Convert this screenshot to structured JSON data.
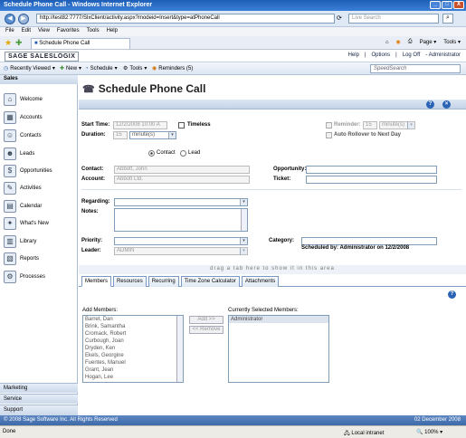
{
  "window": {
    "title": "Schedule Phone Call - Windows Internet Explorer",
    "min": "_",
    "max": "□",
    "close": "X"
  },
  "browser": {
    "url": "http://test82:7777/SlxClient/activity.aspx?modeid=Insert&type=atPhoneCall",
    "search_placeholder": "Live Search",
    "menu": [
      "File",
      "Edit",
      "View",
      "Favorites",
      "Tools",
      "Help"
    ],
    "tab_label": "Schedule Phone Call",
    "tools": [
      "Page",
      "Tools"
    ]
  },
  "app": {
    "logo": "SAGE SALESLOGIX",
    "header_links": [
      "Help",
      "Options",
      "Log Off",
      "- Administrator"
    ],
    "toolbar": [
      "Recently Viewed",
      "New",
      "Schedule",
      "Tools",
      "Reminders (5)"
    ],
    "speed_search": "SpeedSearch"
  },
  "sidebar": {
    "header": "Sales",
    "items": [
      {
        "label": "Welcome",
        "icon": "welcome-icon"
      },
      {
        "label": "Accounts",
        "icon": "accounts-icon"
      },
      {
        "label": "Contacts",
        "icon": "contacts-icon"
      },
      {
        "label": "Leads",
        "icon": "leads-icon"
      },
      {
        "label": "Opportunities",
        "icon": "opportunities-icon"
      },
      {
        "label": "Activities",
        "icon": "activities-icon"
      },
      {
        "label": "Calendar",
        "icon": "calendar-icon"
      },
      {
        "label": "What's New",
        "icon": "whats-new-icon"
      },
      {
        "label": "Library",
        "icon": "library-icon"
      },
      {
        "label": "Reports",
        "icon": "reports-icon"
      },
      {
        "label": "Processes",
        "icon": "processes-icon"
      }
    ],
    "footer": [
      "Marketing",
      "Service",
      "Support"
    ]
  },
  "page": {
    "title": "Schedule Phone Call",
    "help_icon": "?",
    "close_icon": "×"
  },
  "form": {
    "start_time_label": "Start Time:",
    "start_time": "12/2/2008 10:00 A",
    "timeless_label": "Timeless",
    "duration_label": "Duration:",
    "duration_value": "15",
    "duration_unit": "minute(s)",
    "reminder_label": "Reminder:",
    "reminder_value": "15",
    "reminder_unit": "minute(s)",
    "auto_rollover_label": "Auto Rollover to Next Day",
    "contact_radio": "Contact",
    "lead_radio": "Lead",
    "contact_label": "Contact:",
    "contact_value": "Abbott, John",
    "account_label": "Account:",
    "account_value": "Abbott Ltd.",
    "opportunity_label": "Opportunity:",
    "ticket_label": "Ticket:",
    "regarding_label": "Regarding:",
    "notes_label": "Notes:",
    "priority_label": "Priority:",
    "leader_label": "Leader:",
    "leader_value": "ADMIN",
    "category_label": "Category:",
    "scheduled_by": "Scheduled by: Administrator on 12/2/2008"
  },
  "tabs": {
    "drag_hint": "drag a tab here to show it in this area",
    "items": [
      "Members",
      "Resources",
      "Recurring",
      "Time Zone Calculator",
      "Attachments"
    ],
    "active": "Members"
  },
  "members": {
    "add_label": "Add Members:",
    "selected_label": "Currently Selected Members:",
    "add_button": "Add >>",
    "remove_button": "<< Remove",
    "available": [
      "Barret, Dan",
      "Brink, Samantha",
      "Cromack, Robert",
      "Curbough, Joan",
      "Dryden, Ken",
      "Ekels, Georgine",
      "Fuentes, Manuel",
      "Grant, Jean",
      "Hogan, Lee"
    ],
    "selected": [
      "Administrator"
    ]
  },
  "footer": {
    "copyright": "© 2008 Sage Software Inc. All Rights Reserved",
    "date": "02 December 2008"
  },
  "ie_status": {
    "left": "Done",
    "zone": "Local intranet",
    "zoom": "100%"
  }
}
